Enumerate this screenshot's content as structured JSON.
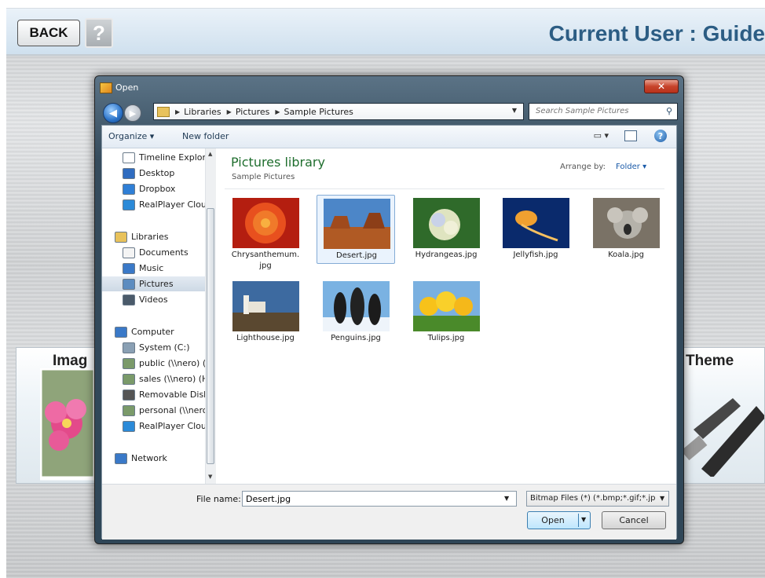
{
  "header": {
    "back_label": "BACK",
    "help_label": "?",
    "title": "Current User : Guide"
  },
  "cards": {
    "left_label": "Imag",
    "right_label": "Theme"
  },
  "dialog": {
    "title": "Open",
    "close_label": "✕",
    "breadcrumb": [
      "Libraries",
      "Pictures",
      "Sample Pictures"
    ],
    "search_placeholder": "Search Sample Pictures",
    "toolbar": {
      "organize": "Organize ▾",
      "new_folder": "New folder"
    },
    "nav_items": [
      {
        "label": "Timeline Explore",
        "icon": "document-icon",
        "color": "#ffffff"
      },
      {
        "label": "Desktop",
        "icon": "desktop-icon",
        "color": "#2f6cc0"
      },
      {
        "label": "Dropbox",
        "icon": "dropbox-icon",
        "color": "#2f7fd6"
      },
      {
        "label": "RealPlayer Cloud",
        "icon": "realplayer-icon",
        "color": "#2b8ad8"
      },
      {
        "label": "Libraries",
        "icon": "libraries-icon",
        "color": "#e8c25c"
      },
      {
        "label": "Documents",
        "icon": "documents-icon",
        "color": "#f4f4f4"
      },
      {
        "label": "Music",
        "icon": "music-icon",
        "color": "#3a79c8"
      },
      {
        "label": "Pictures",
        "icon": "pictures-icon",
        "color": "#5c8cc0"
      },
      {
        "label": "Videos",
        "icon": "videos-icon",
        "color": "#4a5a6a"
      },
      {
        "label": "Computer",
        "icon": "computer-icon",
        "color": "#3a79c8"
      },
      {
        "label": "System (C:)",
        "icon": "drive-icon",
        "color": "#8aa0b4"
      },
      {
        "label": "public (\\\\nero) (",
        "icon": "network-drive-icon",
        "color": "#7a9a6a"
      },
      {
        "label": "sales (\\\\nero) (H",
        "icon": "network-drive-icon",
        "color": "#7a9a6a"
      },
      {
        "label": "Removable Disk",
        "icon": "removable-disk-icon",
        "color": "#555555"
      },
      {
        "label": "personal (\\\\nero",
        "icon": "network-drive-icon",
        "color": "#7a9a6a"
      },
      {
        "label": "RealPlayer Cloud",
        "icon": "realplayer-icon",
        "color": "#2b8ad8"
      },
      {
        "label": "Network",
        "icon": "network-icon",
        "color": "#3a79c8"
      }
    ],
    "library_title": "Pictures library",
    "library_subtitle": "Sample Pictures",
    "arrange_by_label": "Arrange by:",
    "arrange_by_value": "Folder ▾",
    "files": [
      {
        "name": "Chrysanthemum.\njpg",
        "selected": false
      },
      {
        "name": "Desert.jpg",
        "selected": true
      },
      {
        "name": "Hydrangeas.jpg",
        "selected": false
      },
      {
        "name": "Jellyfish.jpg",
        "selected": false
      },
      {
        "name": "Koala.jpg",
        "selected": false
      },
      {
        "name": "Lighthouse.jpg",
        "selected": false
      },
      {
        "name": "Penguins.jpg",
        "selected": false
      },
      {
        "name": "Tulips.jpg",
        "selected": false
      }
    ],
    "file_name_label": "File name:",
    "file_name_value": "Desert.jpg",
    "file_type": "Bitmap Files (*) (*.bmp;*.gif;*.jp",
    "open_label": "Open",
    "cancel_label": "Cancel"
  },
  "colors": {
    "header_title": "#2c5d84",
    "library_title": "#1f6e2e",
    "link_blue": "#1a5aa8"
  }
}
